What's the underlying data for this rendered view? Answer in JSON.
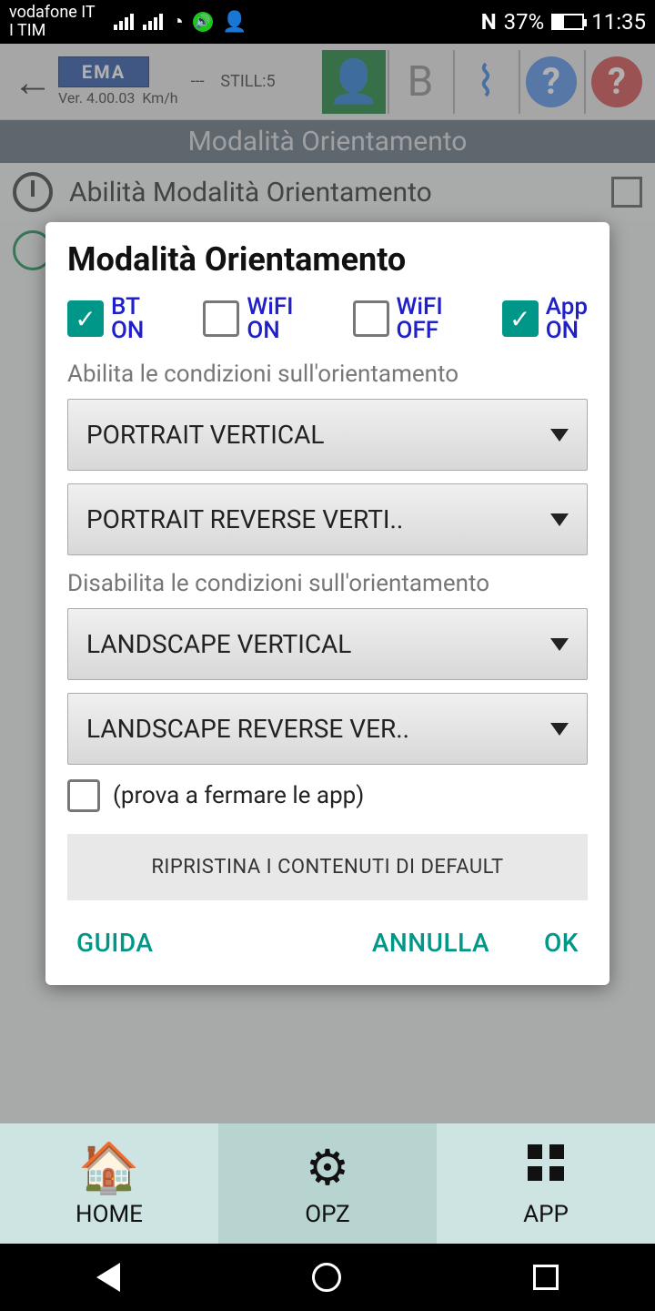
{
  "status": {
    "carrier1": "vodafone IT",
    "carrier2": "I TIM",
    "nfc": "N",
    "battery": "37%",
    "time": "11:35"
  },
  "header": {
    "logo": "EMA",
    "dashes": "---",
    "still": "STILL:5",
    "version": "Ver. 4.00.03",
    "unit": "Km/h"
  },
  "sub_header": "Modalità Orientamento",
  "behind_row": "Abilità Modalità Orientamento",
  "dialog": {
    "title": "Modalità Orientamento",
    "checks": [
      {
        "label1": "BT",
        "label2": "ON",
        "checked": true
      },
      {
        "label1": "WiFI",
        "label2": "ON",
        "checked": false
      },
      {
        "label1": "WiFI",
        "label2": "OFF",
        "checked": false
      },
      {
        "label1": "App",
        "label2": "ON",
        "checked": true
      }
    ],
    "enable_label": "Abilita le condizioni sull'orientamento",
    "enable_options": [
      "PORTRAIT VERTICAL",
      "PORTRAIT REVERSE VERTI.."
    ],
    "disable_label": "Disabilita le condizioni sull'orientamento",
    "disable_options": [
      "LANDSCAPE VERTICAL",
      "LANDSCAPE REVERSE VER.."
    ],
    "stop_apps": "(prova a fermare le app)",
    "restore": "RIPRISTINA I CONTENUTI DI DEFAULT",
    "guida": "GUIDA",
    "annulla": "ANNULLA",
    "ok": "OK"
  },
  "tabs": {
    "home": "HOME",
    "opz": "OPZ",
    "app": "APP"
  }
}
